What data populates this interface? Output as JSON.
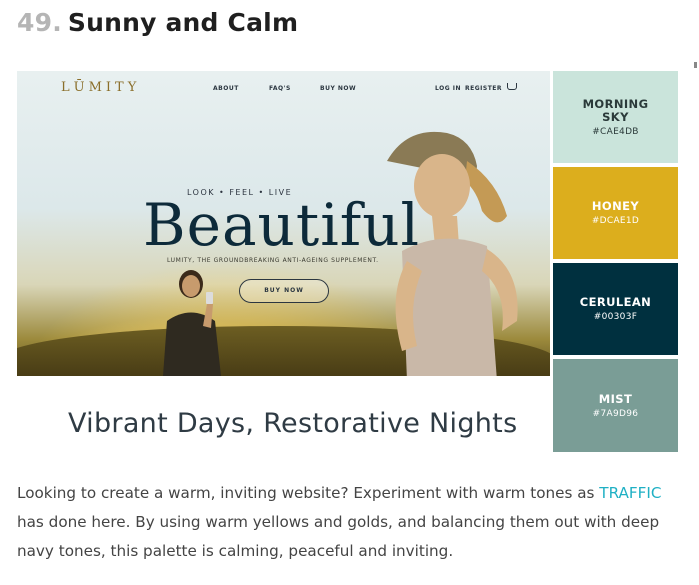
{
  "heading": {
    "number": "49.",
    "title": "Sunny and Calm"
  },
  "hero": {
    "logo": "LŪMITY",
    "nav": [
      "ABOUT",
      "FAQ'S",
      "BUY NOW"
    ],
    "nav_right": [
      "LOG IN",
      "REGISTER"
    ],
    "tagline": "LOOK • FEEL • LIVE",
    "headline": "Beautiful",
    "subline": "LUMITY, THE GROUNDBREAKING ANTI-AGEING SUPPLEMENT.",
    "button": "BUY NOW"
  },
  "caption": "Vibrant Days, Restorative Nights",
  "swatches": [
    {
      "name": "MORNING\nSKY",
      "hex": "#CAE4DB",
      "color": "#CAE4DB",
      "text_color": "#2b3a3a"
    },
    {
      "name": "HONEY",
      "hex": "#DCAE1D",
      "color": "#DCAE1D",
      "text_color": "#ffffff"
    },
    {
      "name": "CERULEAN",
      "hex": "#00303F",
      "color": "#00303F",
      "text_color": "#ffffff"
    },
    {
      "name": "MIST",
      "hex": "#7A9D96",
      "color": "#7A9D96",
      "text_color": "#ffffff"
    }
  ],
  "body": {
    "before": "Looking to create a warm, inviting website? Experiment with warm tones as ",
    "link": "TRAFFIC",
    "after": " has done here. By using warm yellows and golds, and balancing them out with deep navy tones, this palette is calming, peaceful and inviting."
  }
}
